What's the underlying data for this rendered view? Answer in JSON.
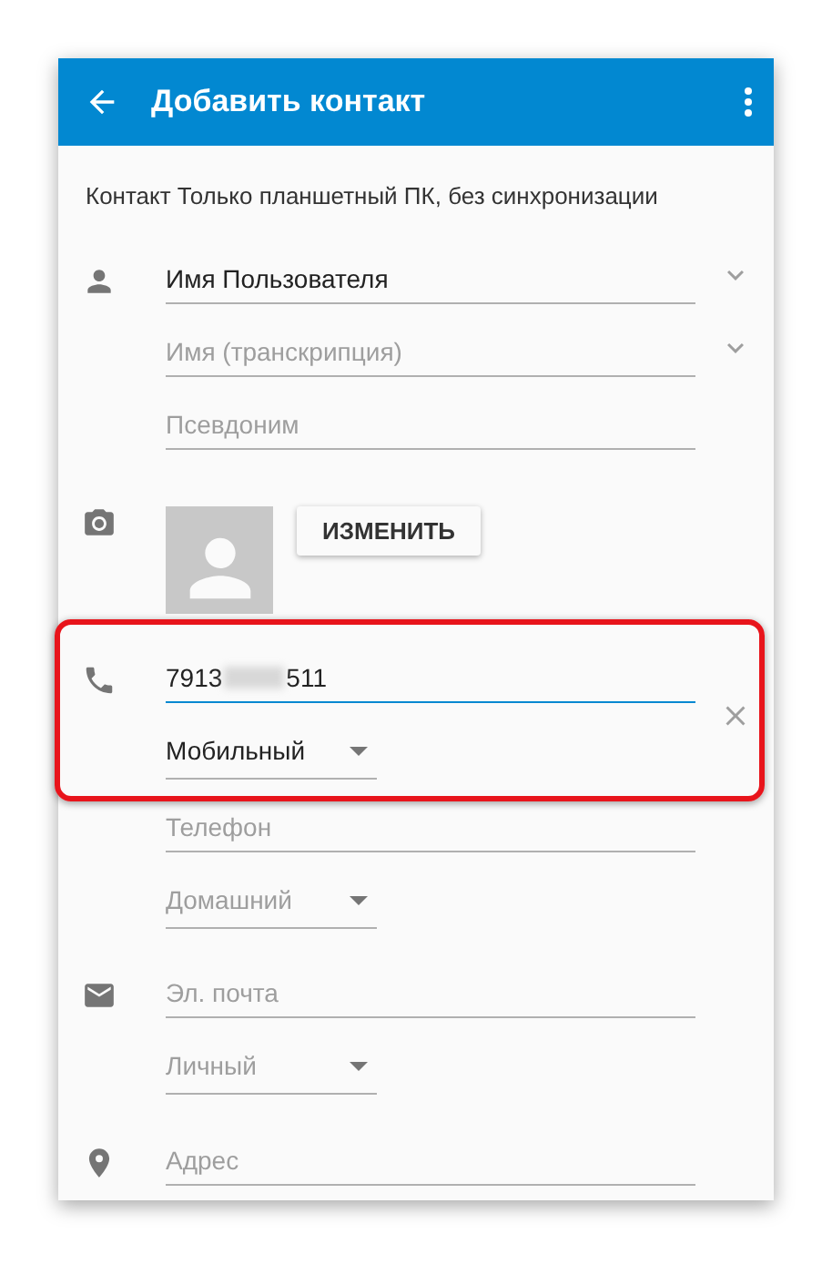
{
  "app_bar": {
    "title": "Добавить контакт"
  },
  "account_line": "Контакт Только планшетный ПК, без синхронизации",
  "sections": [
    {
      "kind": "name",
      "show_icon": true,
      "highlighted": false,
      "removable": false,
      "fields": [
        {
          "kind": "text",
          "value": "Имя Пользователя",
          "expand": true,
          "focused": false
        },
        {
          "kind": "text",
          "placeholder": "Имя (транскрипция)",
          "expand": true,
          "focused": false
        },
        {
          "kind": "text",
          "placeholder": "Псевдоним",
          "expand": false,
          "focused": false
        }
      ]
    },
    {
      "kind": "photo",
      "show_icon": true,
      "highlighted": false,
      "removable": false,
      "button": "ИЗМЕНИТЬ"
    },
    {
      "kind": "phone",
      "show_icon": true,
      "highlighted": true,
      "removable": true,
      "fields": [
        {
          "kind": "redacted",
          "value_start": "7913",
          "value_end": "511",
          "focused": true
        },
        {
          "kind": "dropdown",
          "value": "Мобильный",
          "filled": true
        }
      ]
    },
    {
      "kind": "phone",
      "show_icon": false,
      "highlighted": false,
      "removable": false,
      "fields": [
        {
          "kind": "text",
          "placeholder": "Телефон",
          "expand": false,
          "focused": false
        },
        {
          "kind": "dropdown",
          "value": "Домашний",
          "filled": false
        }
      ]
    },
    {
      "kind": "email",
      "show_icon": true,
      "highlighted": false,
      "removable": false,
      "fields": [
        {
          "kind": "text",
          "placeholder": "Эл. почта",
          "expand": false,
          "focused": false
        },
        {
          "kind": "dropdown",
          "value": "Личный",
          "filled": false
        }
      ]
    },
    {
      "kind": "address",
      "show_icon": true,
      "highlighted": false,
      "removable": false,
      "fields": [
        {
          "kind": "text",
          "placeholder": "Адрес",
          "expand": false,
          "focused": false
        }
      ]
    }
  ]
}
